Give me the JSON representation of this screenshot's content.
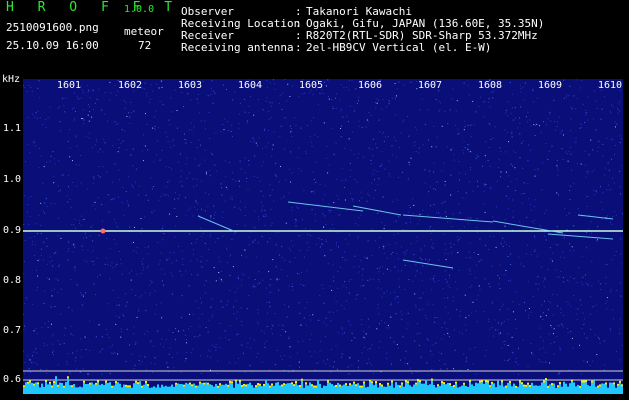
{
  "header": {
    "app_name": "H R O F F T",
    "app_version": "1.0.0",
    "filename": "2510091600.png",
    "datetime": "25.10.09 16:00",
    "meteor_label": "meteor",
    "meteor_count": "72",
    "info": [
      {
        "key": "Observer",
        "sep": ":",
        "value": "Takanori Kawachi"
      },
      {
        "key": "Receiving Location",
        "sep": ":",
        "value": "Ogaki, Gifu, JAPAN (136.60E, 35.35N)"
      },
      {
        "key": "Receiver",
        "sep": ":",
        "value": "R820T2(RTL-SDR) SDR-Sharp 53.372MHz"
      },
      {
        "key": "Receiving antenna",
        "sep": ":",
        "value": "2el-HB9CV Vertical (el. E-W)"
      }
    ]
  },
  "axis": {
    "unit": "kHz",
    "x_ticks": [
      "1601",
      "1602",
      "1603",
      "1604",
      "1605",
      "1606",
      "1607",
      "1608",
      "1609",
      "1610"
    ],
    "y_ticks": [
      "1.1",
      "1.0",
      "0.9",
      "0.8",
      "0.7",
      "0.6"
    ]
  },
  "colors": {
    "background": "#0a0e78",
    "carrier_line": "#c8ffd8",
    "signal_bars": "#1ec8ff",
    "peak_bars": "#ffee00",
    "title_green": "#2ee82e"
  }
}
